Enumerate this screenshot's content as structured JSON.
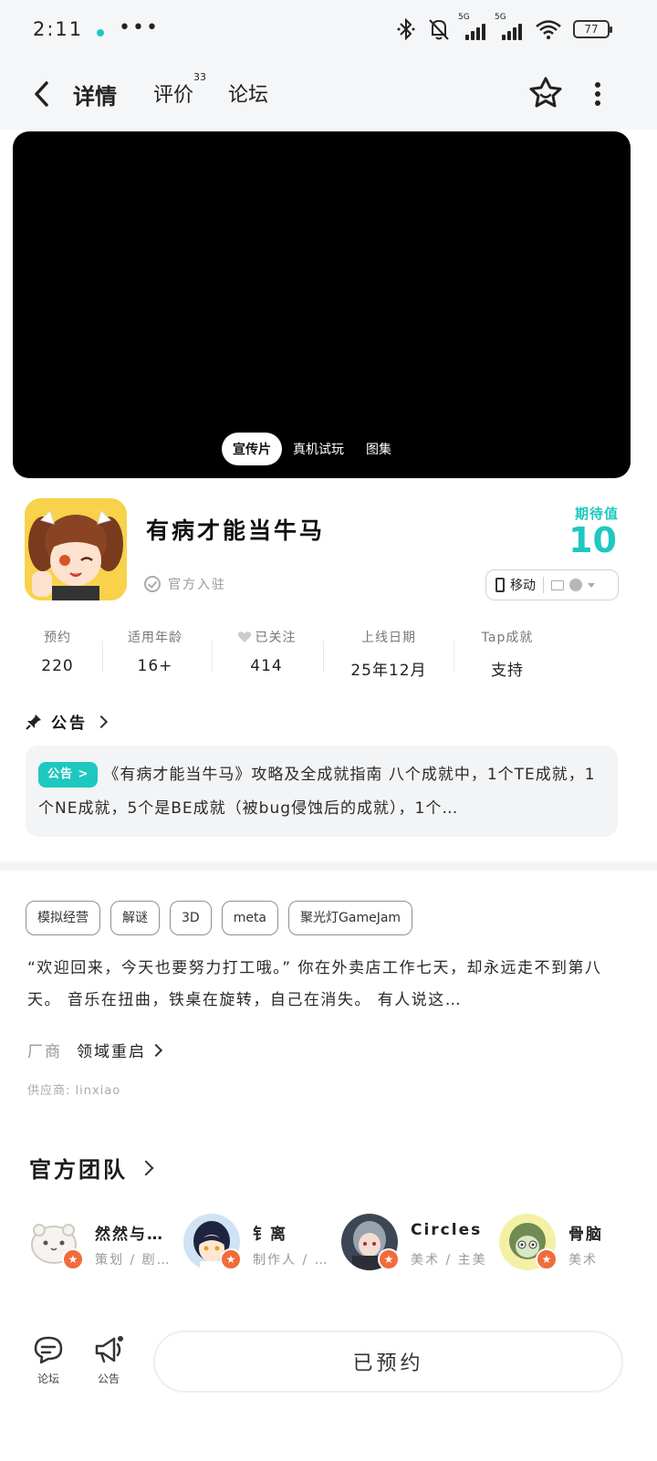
{
  "status_bar": {
    "time": "2:11",
    "more": "•••",
    "battery": "77"
  },
  "nav": {
    "tabs": [
      {
        "label": "详情"
      },
      {
        "label": "评价",
        "count": "33"
      },
      {
        "label": "论坛"
      }
    ]
  },
  "video": {
    "tabs": [
      "宣传片",
      "真机试玩",
      "图集"
    ]
  },
  "game": {
    "title": "有病才能当牛马",
    "official_label": "官方入驻",
    "expect_label": "期待值",
    "expect_value": "10",
    "platform_label": "移动"
  },
  "stats": [
    {
      "label": "预约",
      "value": "220"
    },
    {
      "label": "适用年龄",
      "value": "16+"
    },
    {
      "label": "已关注",
      "value": "414"
    },
    {
      "label": "上线日期",
      "value": "25年12月"
    },
    {
      "label": "Tap成就",
      "value": "支持"
    }
  ],
  "notice": {
    "heading": "公告",
    "tag": "公告 >",
    "text": "《有病才能当牛马》攻略及全成就指南 八个成就中，1个TE成就，1个NE成就，5个是BE成就（被bug侵蚀后的成就），1个…"
  },
  "tags": [
    "模拟经营",
    "解谜",
    "3D",
    "meta",
    "聚光灯GameJam"
  ],
  "description": "“欢迎回来，今天也要努力打工哦。” 你在外卖店工作七天，却永远走不到第八天。 音乐在扭曲，铁桌在旋转，自己在消失。 有人说这…",
  "vendor": {
    "key": "厂商",
    "value": "领域重启"
  },
  "supplier": "供应商: linxiao",
  "team": {
    "heading": "官方团队",
    "members": [
      {
        "name": "然然与…",
        "role": "策划 / 剧…"
      },
      {
        "name": "钅离",
        "role": "制作人 / …"
      },
      {
        "name": "Circles",
        "role": "美术 / 主美"
      },
      {
        "name": "骨脑",
        "role": "美术"
      }
    ]
  },
  "bottom": {
    "forum": "论坛",
    "notice": "公告",
    "reserve": "已预约"
  },
  "colors": {
    "accent": "#1ec8c0",
    "badge": "#f26b3a"
  }
}
